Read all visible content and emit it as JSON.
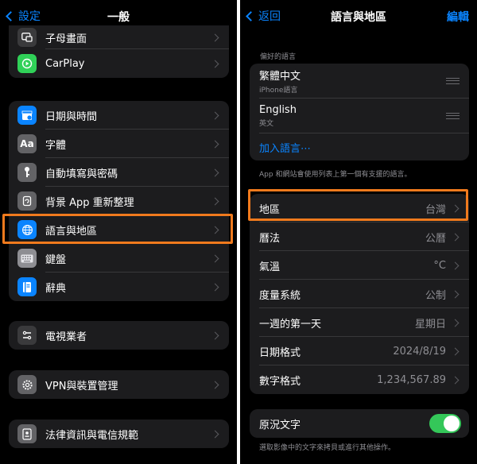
{
  "left": {
    "nav": {
      "back_label": "設定",
      "title": "一般"
    },
    "group1": [
      {
        "label": "子母畫面",
        "icon": "pip-icon",
        "color": "#3a3a3c"
      },
      {
        "label": "CarPlay",
        "icon": "carplay-icon",
        "color": "#30d158"
      }
    ],
    "group2": [
      {
        "label": "日期與時間",
        "icon": "calendar-clock-icon",
        "color": "#0a84ff"
      },
      {
        "label": "字體",
        "icon": "font-icon",
        "color": "#636366"
      },
      {
        "label": "自動填寫與密碼",
        "icon": "key-icon",
        "color": "#636366"
      },
      {
        "label": "背景 App 重新整理",
        "icon": "refresh-icon",
        "color": "#636366"
      },
      {
        "label": "語言與地區",
        "icon": "globe-icon",
        "color": "#0a84ff"
      },
      {
        "label": "鍵盤",
        "icon": "keyboard-icon",
        "color": "#8e8e93"
      },
      {
        "label": "辭典",
        "icon": "dictionary-icon",
        "color": "#0a84ff"
      }
    ],
    "group3": [
      {
        "label": "電視業者",
        "icon": "tv-provider-icon",
        "color": "#3a3a3c"
      }
    ],
    "group4": [
      {
        "label": "VPN與裝置管理",
        "icon": "gear-icon",
        "color": "#636366"
      }
    ],
    "group5": [
      {
        "label": "法律資訊與電信規範",
        "icon": "legal-icon",
        "color": "#636366"
      }
    ]
  },
  "right": {
    "nav": {
      "back_label": "返回",
      "title": "語言與地區",
      "edit_label": "編輯"
    },
    "preferred_caption": "偏好的語言",
    "languages": [
      {
        "name": "繁體中文",
        "sub": "iPhone語言"
      },
      {
        "name": "English",
        "sub": "英文"
      }
    ],
    "add_language": "加入語言⋯",
    "language_footer": "App 和網站會使用列表上第一個有支援的語言。",
    "settings": [
      {
        "label": "地區",
        "value": "台灣"
      },
      {
        "label": "曆法",
        "value": "公曆"
      },
      {
        "label": "氣溫",
        "value": "°C"
      },
      {
        "label": "度量系統",
        "value": "公制"
      },
      {
        "label": "一週的第一天",
        "value": "星期日"
      },
      {
        "label": "日期格式",
        "value": "2024/8/19"
      },
      {
        "label": "數字格式",
        "value": "1,234,567.89"
      }
    ],
    "live_text": {
      "label": "原況文字",
      "enabled": true
    },
    "live_text_footer": "選取影像中的文字來拷貝或進行其他操作。"
  },
  "colors": {
    "accent": "#0a84ff",
    "highlight": "#f07a1d",
    "toggle_on": "#34c759"
  }
}
